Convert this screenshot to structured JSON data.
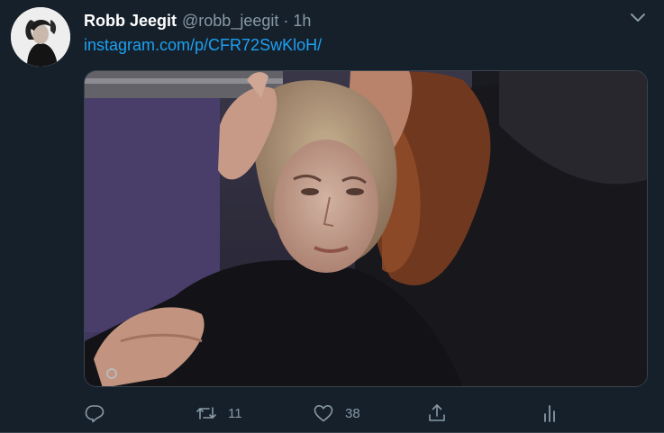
{
  "tweet": {
    "author": {
      "display_name": "Robb Jeegit",
      "handle": "@robb_jeegit"
    },
    "separator": "·",
    "timestamp": "1h",
    "link_text": "instagram.com/p/CFR72SwKloH/",
    "media": {
      "type": "photo"
    },
    "actions": {
      "reply": {
        "icon": "reply-icon"
      },
      "retweet": {
        "icon": "retweet-icon",
        "count": "11"
      },
      "like": {
        "icon": "heart-icon",
        "count": "38"
      },
      "share": {
        "icon": "share-icon"
      },
      "analytics": {
        "icon": "analytics-icon"
      }
    }
  },
  "colors": {
    "background": "#15202b",
    "text_primary": "#ffffff",
    "text_secondary": "#8899a6",
    "link": "#1da1f2",
    "border": "#38444d"
  }
}
